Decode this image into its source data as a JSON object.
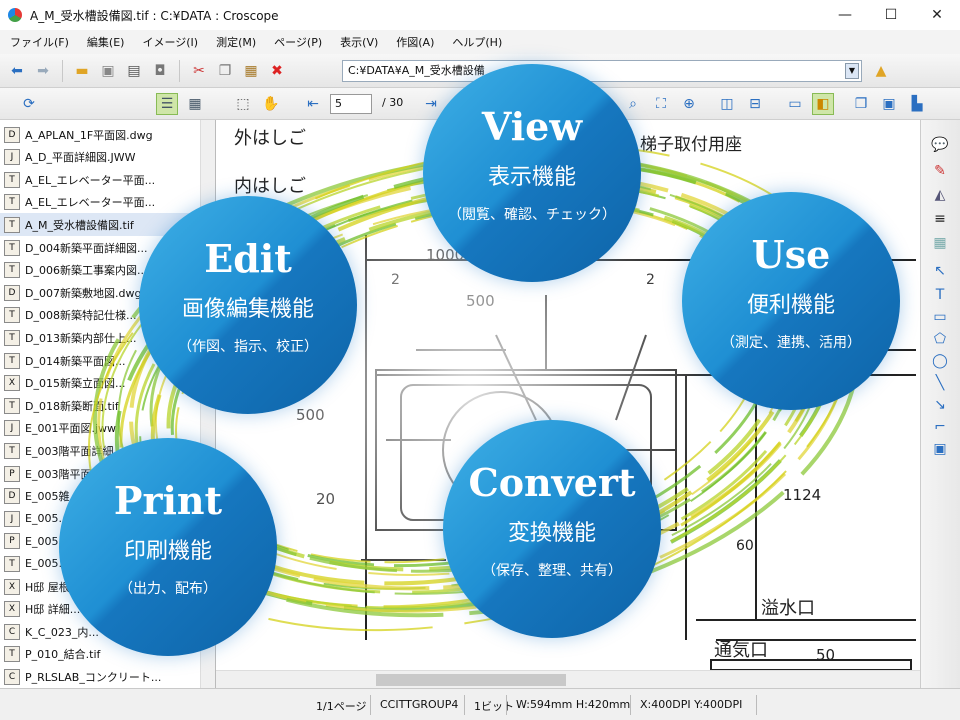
{
  "window": {
    "title": "A_M_受水槽設備図.tif : C:¥DATA : Croscope",
    "minimize": "—",
    "maximize": "☐",
    "close": "✕"
  },
  "menu": [
    "ファイル(F)",
    "編集(E)",
    "イメージ(I)",
    "測定(M)",
    "ページ(P)",
    "表示(V)",
    "作図(A)",
    "ヘルプ(H)"
  ],
  "path_box": {
    "value": "C:¥DATA¥A_M_受水槽設備"
  },
  "page_nav": {
    "current": "5",
    "total": "/ 30"
  },
  "files": [
    {
      "name": "A_APLAN_1F平面図.dwg",
      "icon": "D"
    },
    {
      "name": "A_D_平面詳細図.JWW",
      "icon": "J"
    },
    {
      "name": "A_EL_エレベーター平面...",
      "icon": "T"
    },
    {
      "name": "A_EL_エレベーター平面...",
      "icon": "T"
    },
    {
      "name": "A_M_受水槽設備図.tif",
      "icon": "T",
      "selected": true
    },
    {
      "name": "D_004新築平面詳細図...",
      "icon": "T"
    },
    {
      "name": "D_006新築工事案内図...",
      "icon": "T"
    },
    {
      "name": "D_007新築敷地図.dwg",
      "icon": "D"
    },
    {
      "name": "D_008新築特記仕様...",
      "icon": "T"
    },
    {
      "name": "D_013新築内部仕上...",
      "icon": "T"
    },
    {
      "name": "D_014新築平面図...",
      "icon": "T"
    },
    {
      "name": "D_015新築立面図...",
      "icon": "X"
    },
    {
      "name": "D_018新築断面.tif",
      "icon": "T"
    },
    {
      "name": "E_001平面図.jww",
      "icon": "J"
    },
    {
      "name": "E_003階平面詳細...",
      "icon": "T"
    },
    {
      "name": "E_003階平面...",
      "icon": "P"
    },
    {
      "name": "E_005雑...",
      "icon": "D"
    },
    {
      "name": "E_005...",
      "icon": "J"
    },
    {
      "name": "E_005...",
      "icon": "P"
    },
    {
      "name": "E_005...",
      "icon": "T"
    },
    {
      "name": "H邸 屋根...",
      "icon": "X"
    },
    {
      "name": "H邸 詳細...",
      "icon": "X"
    },
    {
      "name": "K_C_023_内...",
      "icon": "C"
    },
    {
      "name": "P_010_結合.tif",
      "icon": "T"
    },
    {
      "name": "P_RLSLAB_コンクリート...",
      "icon": "C"
    }
  ],
  "status": {
    "page": "1/1ページ",
    "compression": "CCITTGROUP4",
    "bits": "1ビット",
    "size": "W:594mm H:420mm",
    "dpi": "X:400DPI Y:400DPI"
  },
  "drawing_labels": {
    "outer_ladder": "外はしご",
    "inner_ladder": "内はしご",
    "ladder_mount": "梯子取付用座",
    "dim_1000": "1000",
    "dim_500": "500",
    "dim_2a": "2",
    "dim_2b": "2",
    "dim_20": "20",
    "dim_1124": "1124",
    "dim_60": "60",
    "overflow": "溢水口",
    "vent": "通気口",
    "vent_size": "50",
    "dim_500v": "500"
  },
  "features": [
    {
      "title": "View",
      "subtitle": "表示機能",
      "desc": "（閲覧、確認、チェック）"
    },
    {
      "title": "Edit",
      "subtitle": "画像編集機能",
      "desc": "（作図、指示、校正）"
    },
    {
      "title": "Use",
      "subtitle": "便利機能",
      "desc": "（測定、連携、活用）"
    },
    {
      "title": "Print",
      "subtitle": "印刷機能",
      "desc": "（出力、配布）"
    },
    {
      "title": "Convert",
      "subtitle": "変換機能",
      "desc": "（保存、整理、共有）"
    }
  ],
  "colors": {
    "circle_light": "#3fb0e6",
    "circle_dark": "#0e64a8",
    "ring_yellow": "#d4d21a",
    "ring_green": "#6fbf2a"
  }
}
